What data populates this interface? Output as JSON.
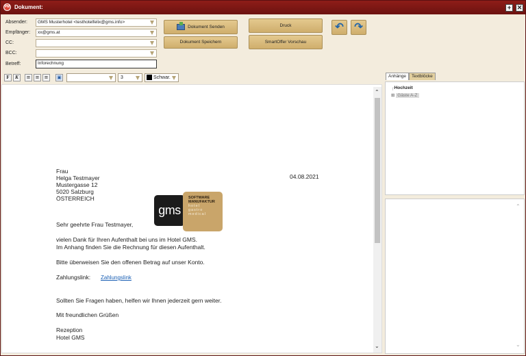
{
  "window": {
    "title": "Dokument:",
    "maximize_glyph": "+",
    "close_glyph": "✕"
  },
  "header": {
    "absender_label": "Absender:",
    "absender_value": "GMS Musterhotel <testhotelfelix@gms.info>",
    "empfaenger_label": "Empfänger:",
    "empfaenger_value": "xx@gms.at",
    "cc_label": "CC:",
    "cc_value": "",
    "bcc_label": "BCC:",
    "bcc_value": "",
    "betreff_label": "Betreff:",
    "betreff_value": "Inforechnung"
  },
  "buttons": {
    "send": "Dokument Senden",
    "save": "Dokument Speichern",
    "print": "Druck",
    "preview": "SmartOffer Vorschau"
  },
  "toolbar": {
    "bold": "F",
    "italic": "K",
    "font_value": "",
    "size_value": "3",
    "color_value": "Schwar."
  },
  "logo": {
    "mark": "gms",
    "line1": "SOFTWARE",
    "line2": "MANUFAKTUR",
    "line3": "hotel",
    "line4": "gastro",
    "line5": "medical"
  },
  "letter": {
    "salutation_line": "Frau",
    "name": "Helga Testmayer",
    "street": "Mustergasse 12",
    "city": "5020 Salzburg",
    "country": "ÖSTERREICH",
    "date": "04.08.2021",
    "greeting": "Sehr geehrte Frau Testmayer,",
    "p1": "vielen Dank für Ihren Aufenthalt bei uns im Hotel GMS.",
    "p2": "Im Anhang finden Sie die Rechnung für diesen Aufenthalt.",
    "p3": "Bitte überweisen Sie den offenen Betrag auf unser Konto.",
    "link_label": "Zahlungslink:",
    "link_text": "Zahlungslink",
    "p4": "Sollten Sie Fragen haben, helfen wir Ihnen jederzeit gern weiter.",
    "closing": "Mit freundlichen Grüßen",
    "sign1": "Rezeption",
    "sign2": "Hotel GMS"
  },
  "side_panel": {
    "tabs": [
      {
        "label": "Anhänge"
      },
      {
        "label": "Textblöcke"
      }
    ],
    "tree": [
      {
        "label": "Hochzeit"
      },
      {
        "label": "Gäste A-Z"
      }
    ]
  },
  "colors": {
    "titlebar": "#7a1712",
    "button": "#d8bb7c",
    "link": "#1a5fb4",
    "background": "#f3ecdd"
  }
}
